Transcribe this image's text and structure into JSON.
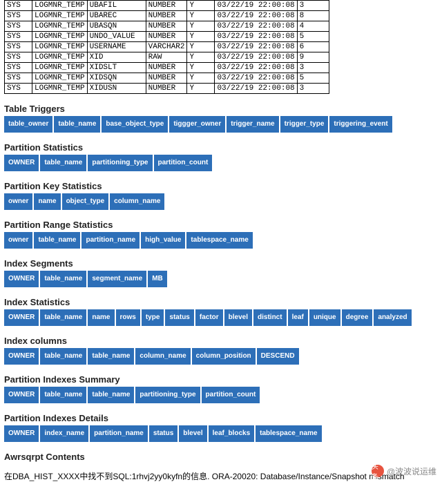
{
  "rows": [
    [
      "SYS",
      "LOGMNR_TEMP",
      "UBAFIL",
      "NUMBER",
      "Y",
      "03/22/19 22:00:08",
      "3"
    ],
    [
      "SYS",
      "LOGMNR_TEMP",
      "UBAREC",
      "NUMBER",
      "Y",
      "03/22/19 22:00:08",
      "8"
    ],
    [
      "SYS",
      "LOGMNR_TEMP",
      "UBASQN",
      "NUMBER",
      "Y",
      "03/22/19 22:00:08",
      "4"
    ],
    [
      "SYS",
      "LOGMNR_TEMP",
      "UNDO_VALUE",
      "NUMBER",
      "Y",
      "03/22/19 22:00:08",
      "5"
    ],
    [
      "SYS",
      "LOGMNR_TEMP",
      "USERNAME",
      "VARCHAR2",
      "Y",
      "03/22/19 22:00:08",
      "6"
    ],
    [
      "SYS",
      "LOGMNR_TEMP",
      "XID",
      "RAW",
      "Y",
      "03/22/19 22:00:08",
      "9"
    ],
    [
      "SYS",
      "LOGMNR_TEMP",
      "XIDSLT",
      "NUMBER",
      "Y",
      "03/22/19 22:00:08",
      "3"
    ],
    [
      "SYS",
      "LOGMNR_TEMP",
      "XIDSQN",
      "NUMBER",
      "Y",
      "03/22/19 22:00:08",
      "5"
    ],
    [
      "SYS",
      "LOGMNR_TEMP",
      "XIDUSN",
      "NUMBER",
      "Y",
      "03/22/19 22:00:08",
      "3"
    ]
  ],
  "sections": [
    {
      "title": "Table Triggers",
      "tags": [
        "table_owner",
        "table_name",
        "base_object_type",
        "tiggger_owner",
        "trigger_name",
        "trigger_type",
        "triggering_event"
      ]
    },
    {
      "title": "Partition Statistics",
      "tags": [
        "OWNER",
        "table_name",
        "partitioning_type",
        "partition_count"
      ]
    },
    {
      "title": "Partition Key Statistics",
      "tags": [
        "owner",
        "name",
        "object_type",
        "column_name"
      ]
    },
    {
      "title": "Partition Range Statistics",
      "tags": [
        "owner",
        "table_name",
        "partition_name",
        "high_value",
        "tablespace_name"
      ]
    },
    {
      "title": "Index Segments",
      "tags": [
        "OWNER",
        "table_name",
        "segment_name",
        "MB"
      ]
    },
    {
      "title": "Index Statistics",
      "tags": [
        "OWNER",
        "table_name",
        "name",
        "rows",
        "type",
        "status",
        "factor",
        "blevel",
        "distinct",
        "leaf",
        "unique",
        "degree",
        "analyzed"
      ]
    },
    {
      "title": "Index columns",
      "tags": [
        "OWNER",
        "table_name",
        "table_name",
        "column_name",
        "column_position",
        "DESCEND"
      ]
    },
    {
      "title": "Partition Indexes Summary",
      "tags": [
        "OWNER",
        "table_name",
        "table_name",
        "partitioning_type",
        "partition_count"
      ]
    },
    {
      "title": "Partition Indexes Details",
      "tags": [
        "OWNER",
        "index_name",
        "partition_name",
        "status",
        "blevel",
        "leaf_blocks",
        "tablespace_name"
      ]
    },
    {
      "title": "Awrsqrpt Contents",
      "tags": []
    }
  ],
  "watermark": {
    "icon": "头条",
    "text": "@波波说运维"
  },
  "error": "在DBA_HIST_XXXX中找不到SQL:1rhvj2yy0kyfn的信息. ORA-20020: Database/Instance/Snapshot mismatch"
}
